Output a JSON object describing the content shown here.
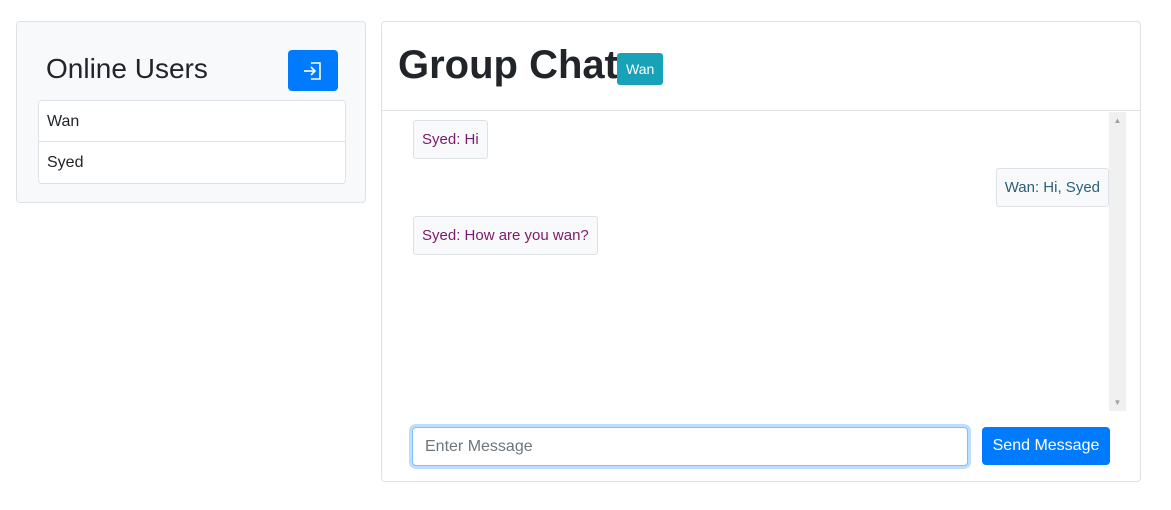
{
  "sidebar": {
    "title": "Online Users",
    "logout_icon": "sign-in-icon",
    "users": [
      {
        "name": "Wan"
      },
      {
        "name": "Syed"
      }
    ]
  },
  "chat": {
    "title": "Group Chat",
    "current_user_badge": "Wan",
    "messages": [
      {
        "text": "Syed: Hi",
        "direction": "incoming"
      },
      {
        "text": "Wan: Hi, Syed",
        "direction": "outgoing"
      },
      {
        "text": "Syed: How are you wan?",
        "direction": "incoming"
      }
    ],
    "input": {
      "value": "",
      "placeholder": "Enter Message"
    },
    "send_label": "Send Message"
  },
  "colors": {
    "primary": "#007bff",
    "badge": "#17a2b8",
    "incoming_text": "#7b1a6b",
    "outgoing_text": "#2c5f7a"
  }
}
